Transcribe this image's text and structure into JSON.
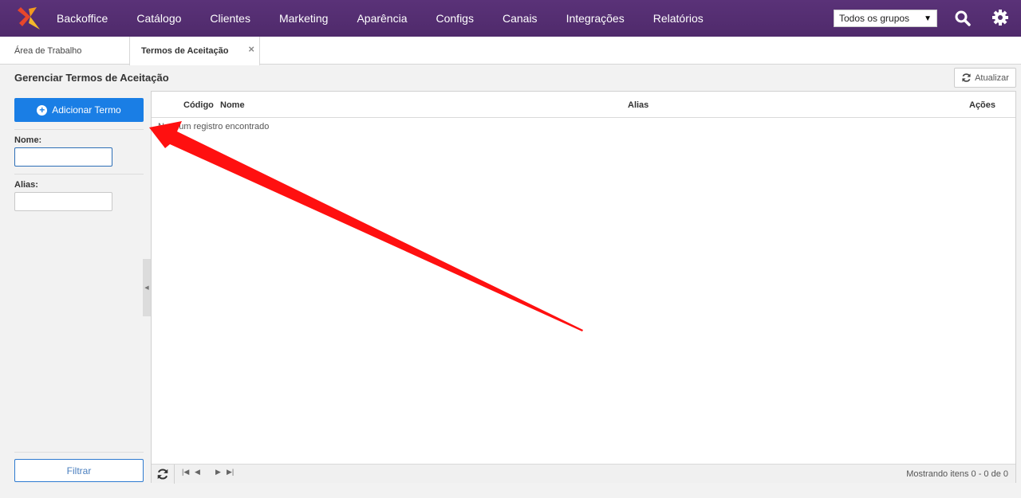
{
  "topnav": {
    "items": [
      "Backoffice",
      "Catálogo",
      "Clientes",
      "Marketing",
      "Aparência",
      "Configs",
      "Canais",
      "Integrações",
      "Relatórios"
    ],
    "group_select": "Todos os grupos"
  },
  "tabs": {
    "work_area": "Área de Trabalho",
    "active": "Termos de Aceitação",
    "close": "×"
  },
  "page": {
    "title": "Gerenciar Termos de Aceitação",
    "refresh_label": "Atualizar"
  },
  "sidebar": {
    "add_button": "Adicionar Termo",
    "name_label": "Nome:",
    "name_value": "",
    "alias_label": "Alias:",
    "alias_value": "",
    "filter_button": "Filtrar"
  },
  "grid": {
    "columns": [
      "Código",
      "Nome",
      "Alias",
      "Ações"
    ],
    "empty_message": "Nenhum registro encontrado",
    "pager_info": "Mostrando itens 0 - 0 de 0"
  },
  "colors": {
    "nav_bg": "#5a3278",
    "primary": "#1a7ee5",
    "annotation": "#ff0000"
  }
}
